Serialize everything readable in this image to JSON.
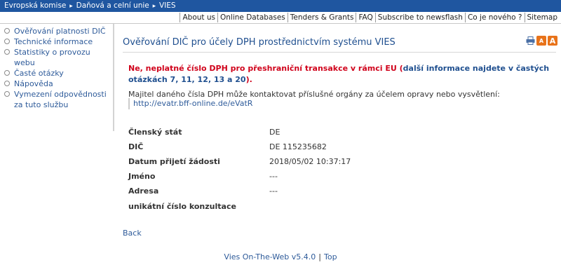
{
  "breadcrumb": [
    "Evropská komise",
    "Daňová a celní unie",
    "VIES"
  ],
  "top_links": [
    "About us",
    "Online Databases",
    "Tenders & Grants",
    "FAQ",
    "Subscribe to newsflash",
    "Co je nového ?",
    "Sitemap"
  ],
  "sidebar": {
    "items": [
      {
        "label": "Ověřování platnosti DIČ"
      },
      {
        "label": "Technické informace"
      },
      {
        "label": "Statistiky o provozu webu"
      },
      {
        "label": "Časté otázky"
      },
      {
        "label": "Nápověda"
      },
      {
        "label": "Vymezení odpovědnosti za tuto službu"
      }
    ]
  },
  "main": {
    "title": "Ověřování DIČ pro účely DPH prostřednictvím systému VIES",
    "tools": {
      "print": "print-icon",
      "font_small": "A",
      "font_large": "A"
    },
    "error_red": "Ne, neplatné číslo DPH pro přeshraniční transakce v rámci EU",
    "error_blue": "další informace najdete v častých otázkách 7, 11, 12, 13 a 20",
    "error_open": " (",
    "error_close": ").",
    "note": "Majitel daného čísla DPH může kontaktovat příslušné orgány za účelem opravy nebo vysvětlení:",
    "note_link": "http://evatr.bff-online.de/eVatR",
    "details": [
      {
        "label": "Členský stát",
        "value": "DE"
      },
      {
        "label": "DIČ",
        "value": "DE 115235682"
      },
      {
        "label": "Datum přijetí žádosti",
        "value": "2018/05/02 10:37:17"
      },
      {
        "label": "Jméno",
        "value": "---"
      },
      {
        "label": "Adresa",
        "value": "---"
      },
      {
        "label": "unikátní číslo konzultace",
        "value": ""
      }
    ],
    "back": "Back"
  },
  "footer": {
    "version": "Vies On-The-Web v5.4.0",
    "separator": "|",
    "top": "Top"
  },
  "colors": {
    "topbar": "#1f56a0",
    "link": "#2e5b9a",
    "error": "#d0021b",
    "title": "#1f4f8f"
  }
}
